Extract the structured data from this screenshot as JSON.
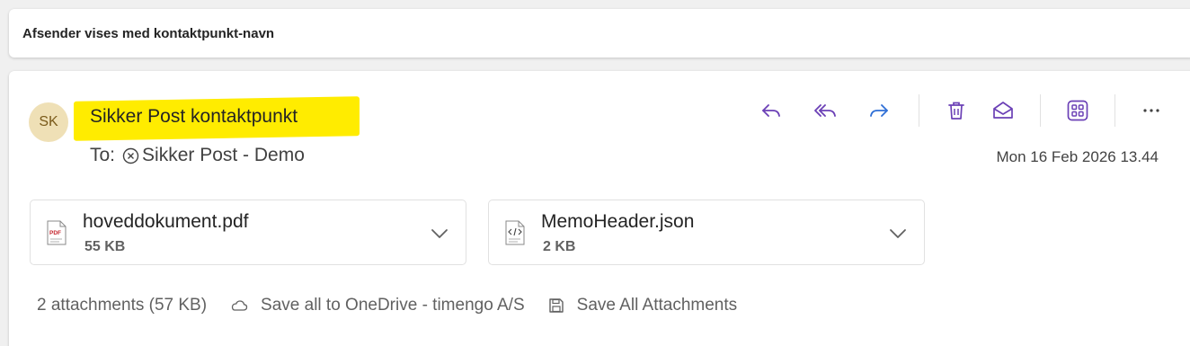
{
  "subject": "Afsender vises med kontaktpunkt-navn",
  "message": {
    "avatar_initials": "SK",
    "sender_name": "Sikker Post kontaktpunkt",
    "to_label": "To:",
    "to_recipient": "Sikker Post - Demo",
    "date": "Mon 16 Feb 2026 13.44",
    "highlight_color": "#ffec00"
  },
  "toolbar": {
    "reply": "reply-icon",
    "reply_all": "reply-all-icon",
    "forward": "forward-icon",
    "delete": "delete-icon",
    "mark_read": "envelope-open-icon",
    "apps": "apps-icon",
    "more": "more-icon",
    "accent_color": "#6b40b6",
    "forward_color": "#2f6fd6"
  },
  "attachments": [
    {
      "name": "hoveddokument.pdf",
      "size": "55 KB",
      "icon": "pdf-file-icon"
    },
    {
      "name": "MemoHeader.json",
      "size": "2 KB",
      "icon": "code-file-icon"
    }
  ],
  "footer": {
    "summary": "2 attachments (57 KB)",
    "save_onedrive": "Save all to OneDrive - timengo A/S",
    "save_all": "Save All Attachments"
  }
}
